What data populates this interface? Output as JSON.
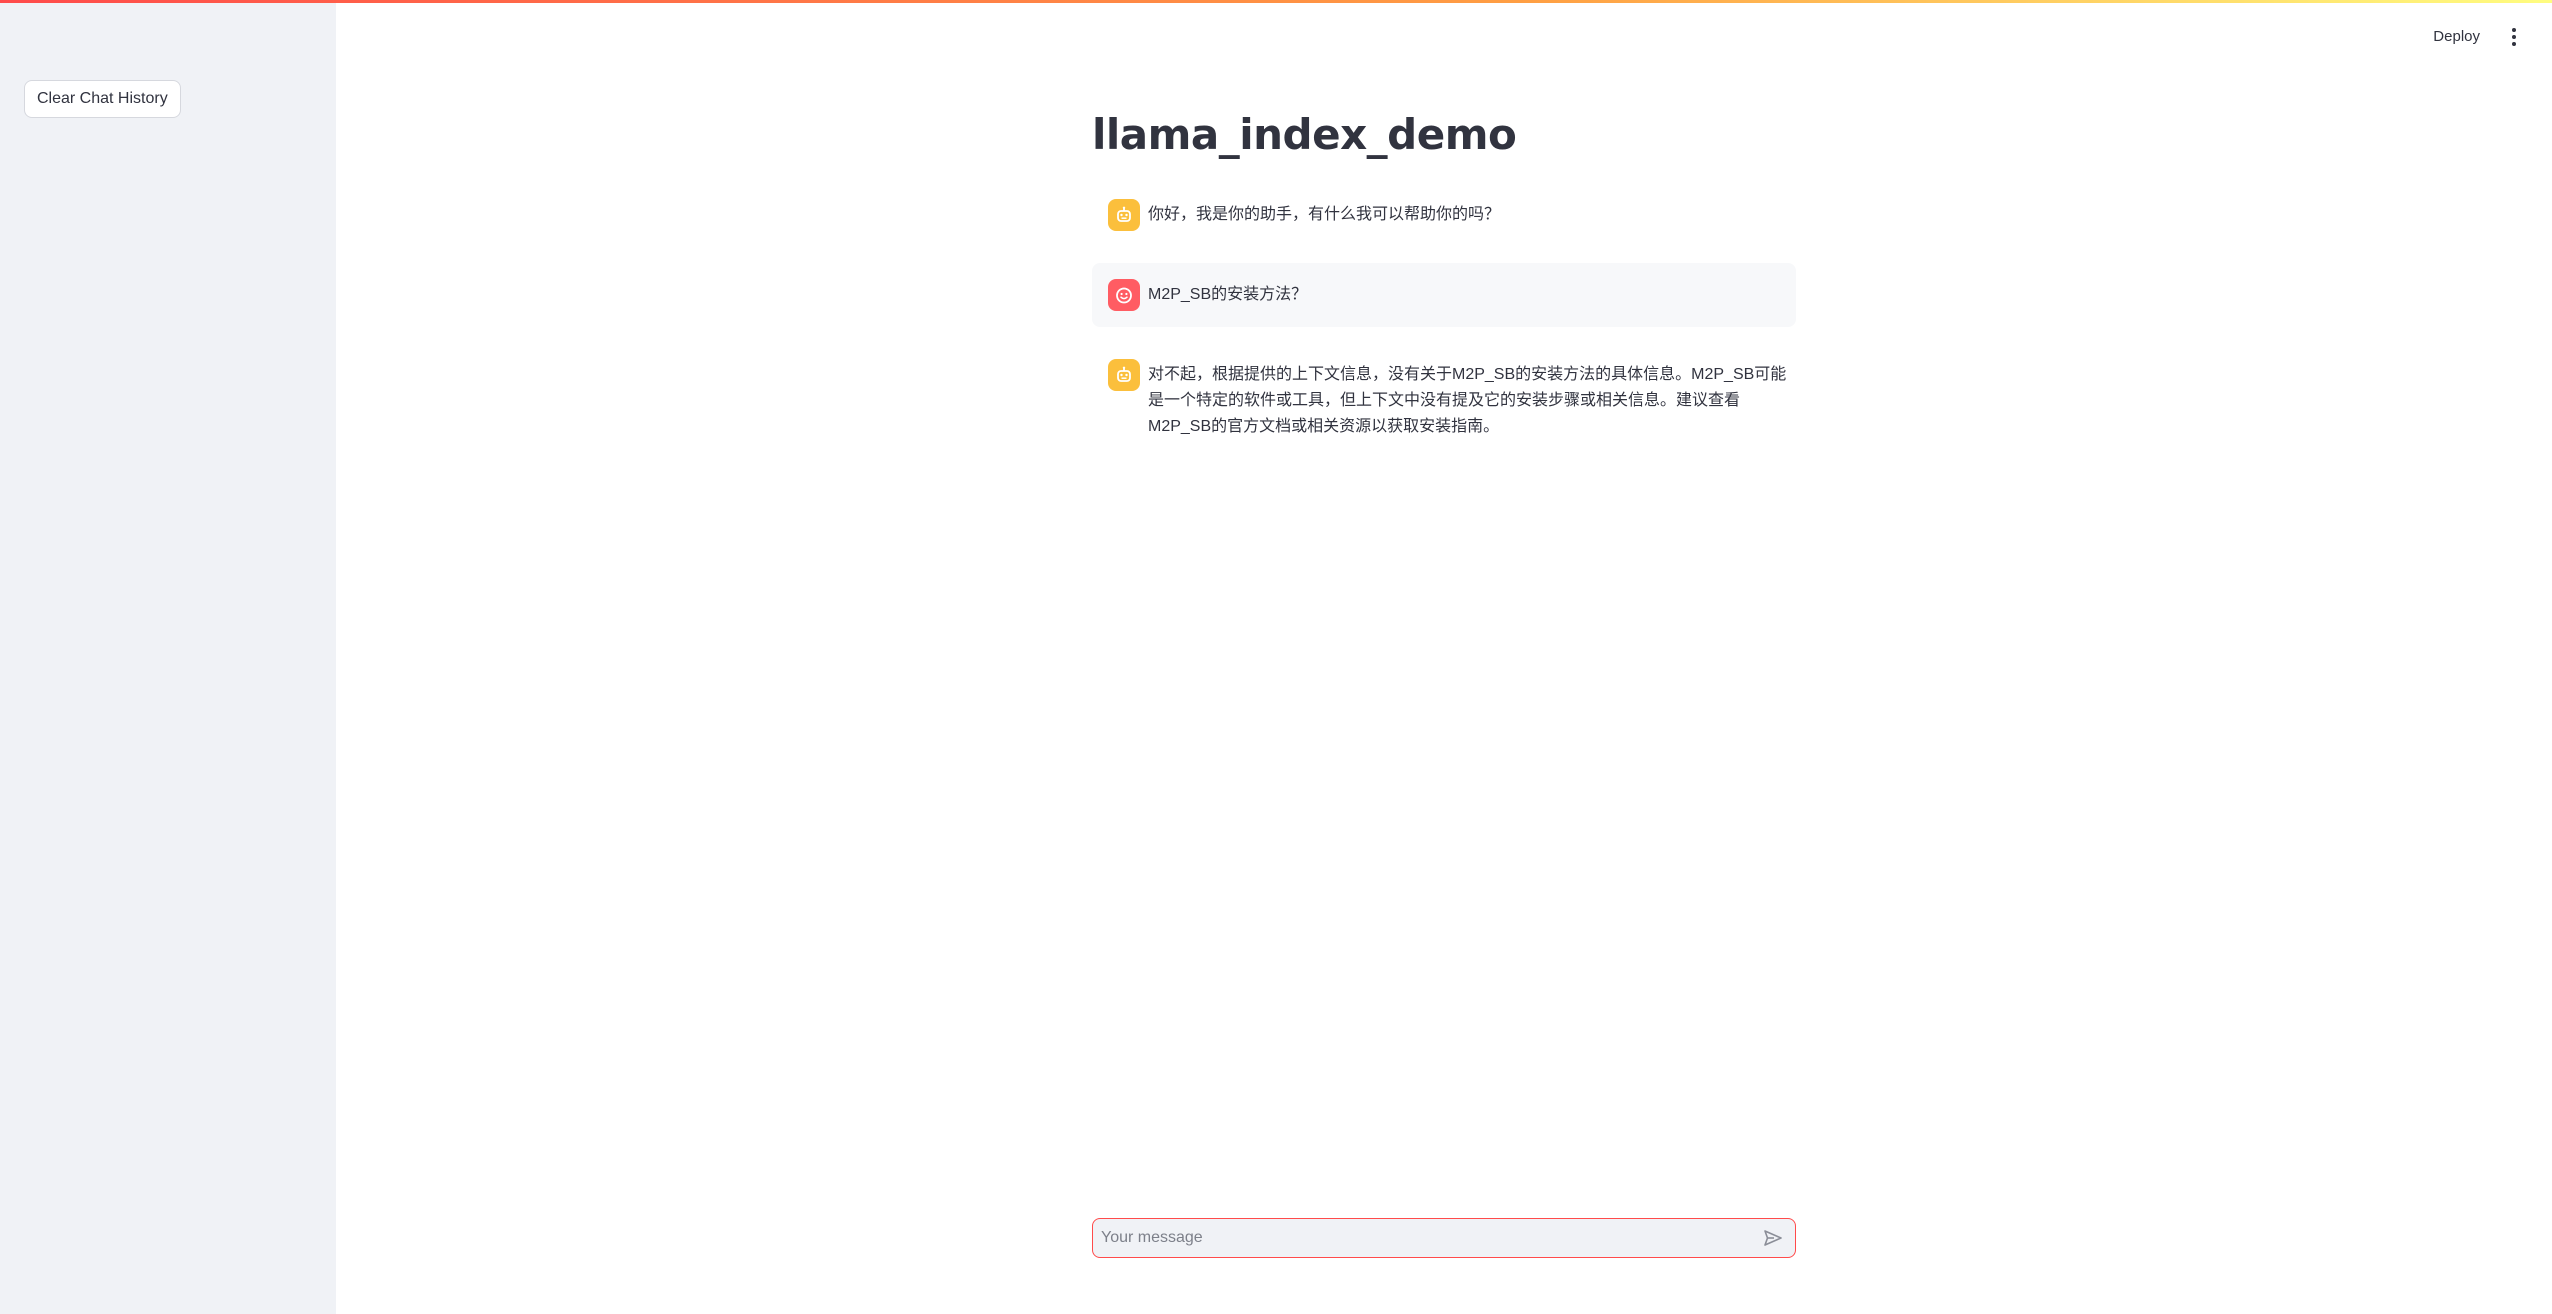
{
  "sidebar": {
    "clear_label": "Clear Chat History"
  },
  "header": {
    "deploy_label": "Deploy"
  },
  "main": {
    "title": "llama_index_demo",
    "messages": [
      {
        "role": "assistant",
        "text": "你好，我是你的助手，有什么我可以帮助你的吗？"
      },
      {
        "role": "user",
        "text": "M2P_SB的安装方法？"
      },
      {
        "role": "assistant",
        "text": "对不起，根据提供的上下文信息，没有关于M2P_SB的安装方法的具体信息。M2P_SB可能是一个特定的软件或工具，但上下文中没有提及它的安装步骤或相关信息。建议查看M2P_SB的官方文档或相关资源以获取安装指南。"
      }
    ]
  },
  "chat_input": {
    "placeholder": "Your message"
  },
  "colors": {
    "accent": "#ff4b4b",
    "assistant_avatar": "#fbbf3c",
    "user_avatar": "#ff5c63",
    "sidebar_bg": "#f0f2f6"
  },
  "icons": {
    "assistant_avatar": "robot-face-icon",
    "user_avatar": "smiley-face-icon",
    "send": "send-arrow-icon",
    "menu": "kebab-menu-icon"
  }
}
